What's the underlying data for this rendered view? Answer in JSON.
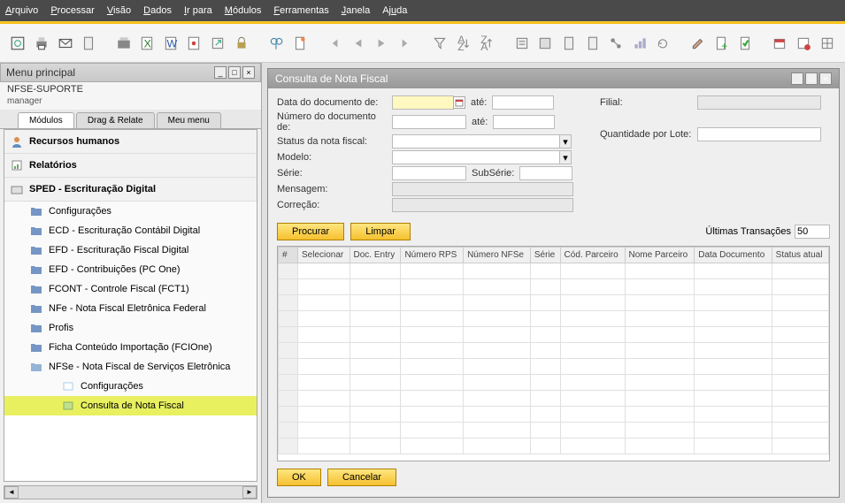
{
  "menubar": {
    "items": [
      "Arquivo",
      "Processar",
      "Visão",
      "Dados",
      "Ir para",
      "Módulos",
      "Ferramentas",
      "Janela",
      "Ajuda"
    ]
  },
  "main_menu": {
    "title": "Menu principal",
    "subtitle": "NFSE-SUPORTE",
    "user": "manager",
    "tabs": [
      "Módulos",
      "Drag & Relate",
      "Meu menu"
    ]
  },
  "tree": {
    "top": [
      {
        "label": "Recursos humanos"
      },
      {
        "label": "Relatórios"
      },
      {
        "label": "SPED - Escrituração Digital"
      }
    ],
    "sped_children": [
      {
        "label": "Configurações"
      },
      {
        "label": "ECD - Escrituração Contábil Digital"
      },
      {
        "label": "EFD - Escrituração Fiscal Digital"
      },
      {
        "label": "EFD - Contribuições (PC One)"
      },
      {
        "label": "FCONT - Controle Fiscal (FCT1)"
      },
      {
        "label": "NFe - Nota Fiscal Eletrônica Federal"
      },
      {
        "label": "Profis"
      },
      {
        "label": "Ficha Conteúdo Importação (FCIOne)"
      },
      {
        "label": "NFSe - Nota Fiscal de Serviços Eletrônica"
      }
    ],
    "nfse_children": [
      {
        "label": "Configurações"
      },
      {
        "label": "Consulta de Nota Fiscal"
      }
    ]
  },
  "form": {
    "title": "Consulta de Nota Fiscal",
    "labels": {
      "data_doc_de": "Data do documento de:",
      "ate": "até:",
      "num_doc_de": "Número do documento de:",
      "status": "Status da nota fiscal:",
      "modelo": "Modelo:",
      "serie": "Série:",
      "subserie": "SubSérie:",
      "mensagem": "Mensagem:",
      "correcao": "Correção:",
      "filial": "Filial:",
      "qtd_lote": "Quantidade por Lote:",
      "ultimas": "Últimas Transações"
    },
    "ultimas_value": "50",
    "buttons": {
      "procurar": "Procurar",
      "limpar": "Limpar",
      "ok": "OK",
      "cancelar": "Cancelar"
    },
    "columns": [
      "Selecionar",
      "Doc. Entry",
      "Número RPS",
      "Número NFSe",
      "Série",
      "Cód. Parceiro",
      "Nome Parceiro",
      "Data Documento",
      "Status atual"
    ]
  }
}
